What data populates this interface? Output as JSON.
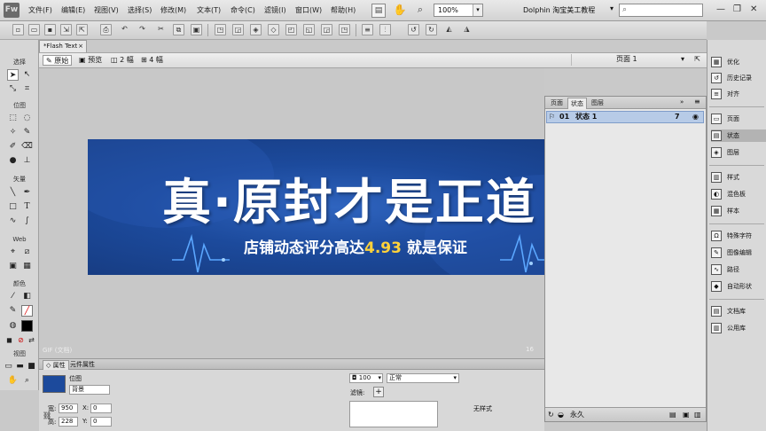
{
  "menubar": {
    "logo": "Fw",
    "items": [
      "文件(F)",
      "编辑(E)",
      "视图(V)",
      "选择(S)",
      "修改(M)",
      "文本(T)",
      "命令(C)",
      "滤镜(I)",
      "窗口(W)",
      "帮助(H)"
    ],
    "zoom": "100%",
    "workspace_title": "Dolphin 淘宝美工教程"
  },
  "document": {
    "tab_label": "*Flash Text",
    "views": [
      "原始",
      "预览",
      "2 幅",
      "4 幅"
    ],
    "page_label": "页面 1"
  },
  "tools": {
    "sections": [
      "选择",
      "位图",
      "矢量",
      "Web",
      "颜色",
      "视图"
    ]
  },
  "banner": {
    "title": "真·原封才是正道",
    "subtitle_pre": "店铺动态评分高达",
    "subtitle_value": "4.93",
    "subtitle_post": "就是保证",
    "colors": {
      "bg": "#1c4a9c",
      "accent": "#ffd23a",
      "text": "#ffffff"
    }
  },
  "canvas_footer": {
    "left": "GIF (文档)",
    "right": "16"
  },
  "states_panel": {
    "tabs": [
      "页面",
      "状态",
      "图层"
    ],
    "active_tab": "状态",
    "rows": [
      {
        "num": "01",
        "name": "状态 1",
        "delay": "7"
      }
    ],
    "footer_label": "永久"
  },
  "right_dock": {
    "groups": [
      [
        "优化",
        "历史记录",
        "对齐"
      ],
      [
        "页面",
        "状态",
        "图层"
      ],
      [
        "样式",
        "混色板",
        "样本"
      ],
      [
        "特殊字符",
        "图像编辑",
        "路径",
        "自动形状"
      ],
      [
        "文档库",
        "公用库"
      ]
    ],
    "active": "状态"
  },
  "properties": {
    "tabs": [
      "属性",
      "元件属性"
    ],
    "object_type": "位图",
    "object_name": "背景",
    "width_label": "宽:",
    "width": "950",
    "height_label": "高:",
    "height": "228",
    "x_label": "X:",
    "x": "0",
    "y_label": "Y:",
    "y": "0",
    "opacity": "100",
    "blend_mode": "正常",
    "filters_label": "滤镜:",
    "style": "无样式"
  }
}
